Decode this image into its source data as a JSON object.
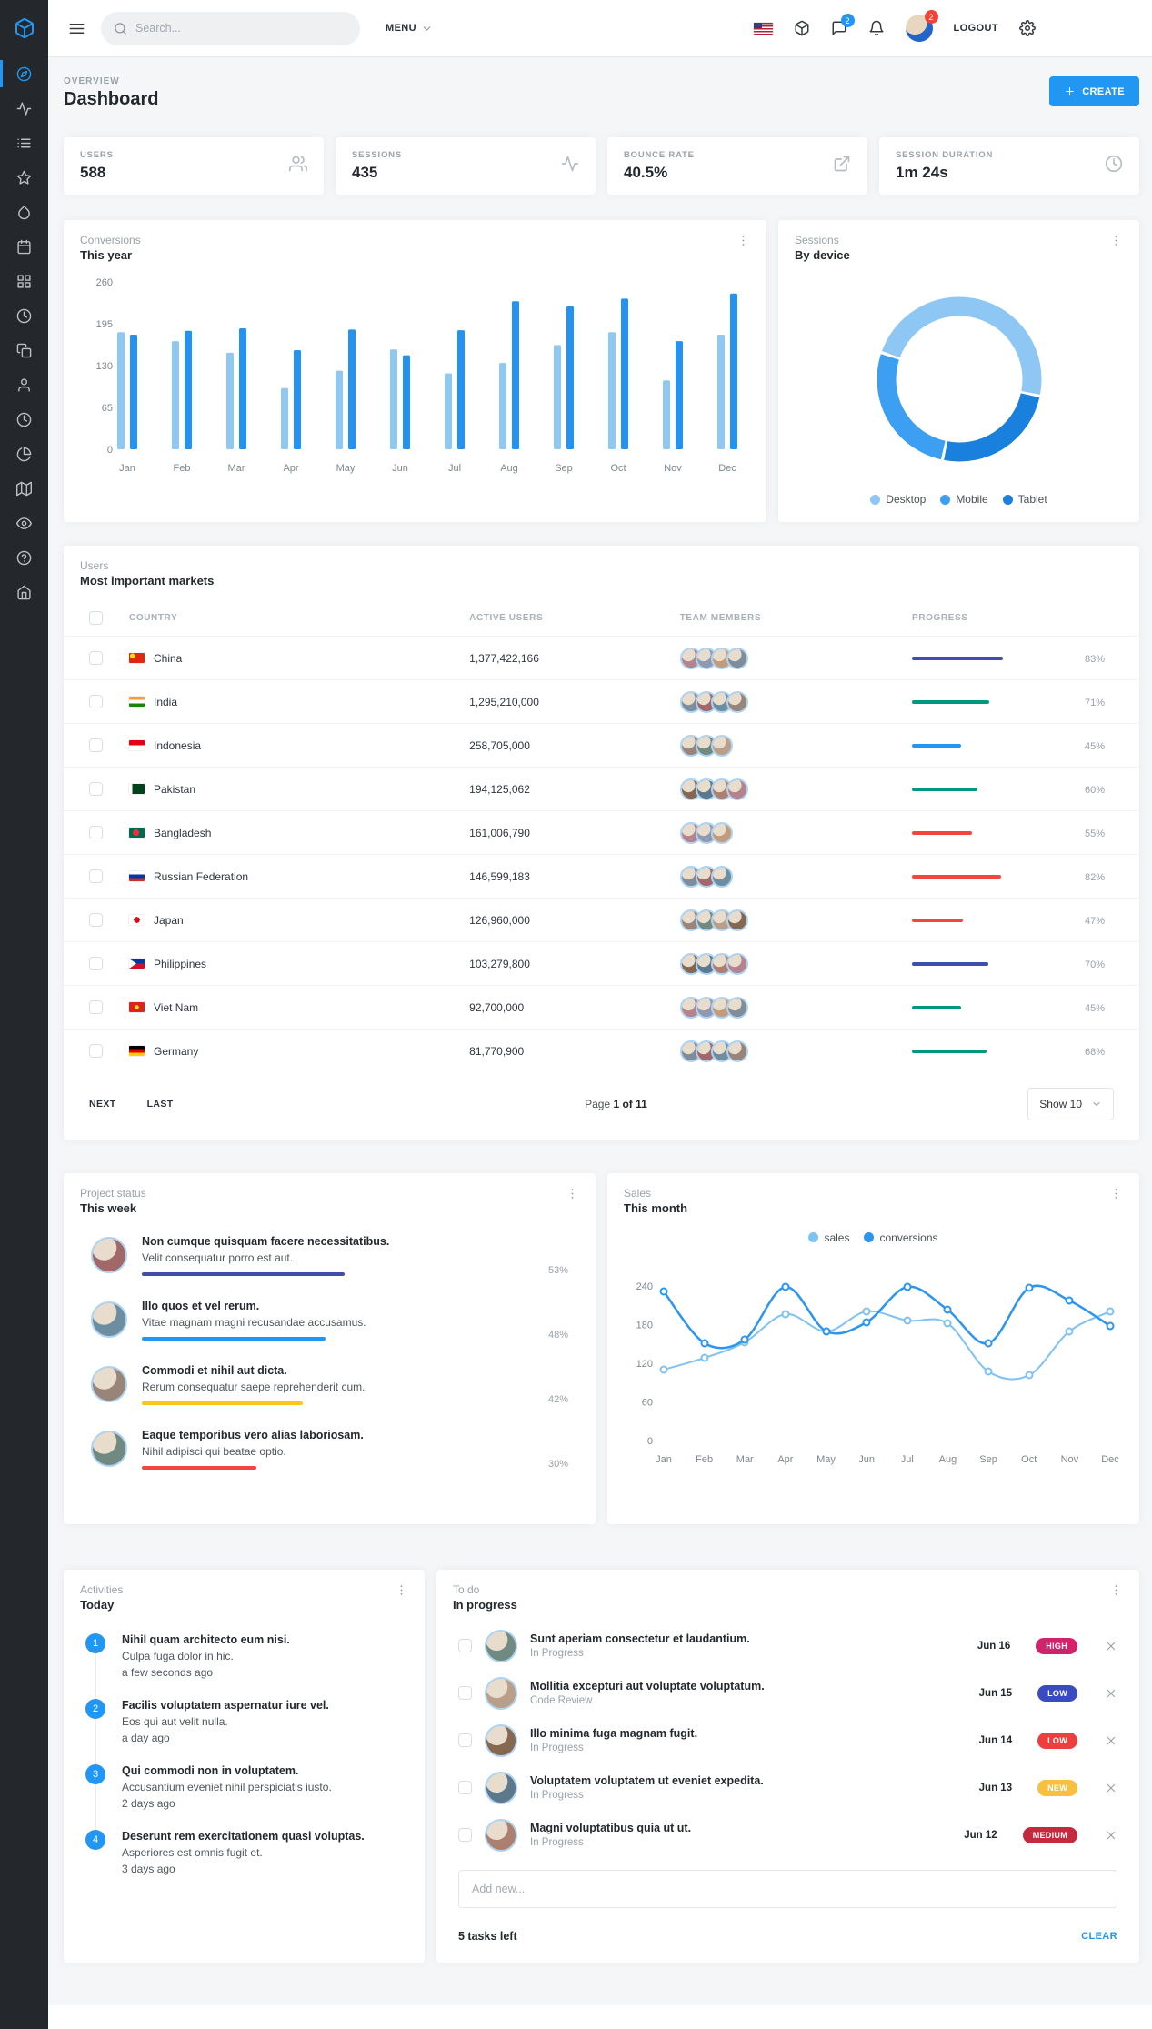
{
  "topbar": {
    "search_placeholder": "Search...",
    "menu": "MENU",
    "logout": "LOGOUT",
    "message_badge": "2",
    "profile_badge": "2"
  },
  "sidebar": {
    "active_index": 0,
    "items": [
      "compass",
      "activity",
      "list",
      "star",
      "droplet",
      "calendar",
      "grid",
      "clock",
      "copy",
      "user",
      "clock",
      "pie",
      "map",
      "eye",
      "help",
      "home"
    ]
  },
  "page_header": {
    "kicker": "OVERVIEW",
    "title": "Dashboard",
    "create": "CREATE"
  },
  "stats": [
    {
      "label": "USERS",
      "value": "588",
      "icon": "users"
    },
    {
      "label": "SESSIONS",
      "value": "435",
      "icon": "activity"
    },
    {
      "label": "BOUNCE RATE",
      "value": "40.5%",
      "icon": "external"
    },
    {
      "label": "SESSION DURATION",
      "value": "1m 24s",
      "icon": "clock"
    }
  ],
  "conversions": {
    "kicker": "Conversions",
    "title": "This year",
    "type": "bar",
    "categories": [
      "Jan",
      "Feb",
      "Mar",
      "Apr",
      "May",
      "Jun",
      "Jul",
      "Aug",
      "Sep",
      "Oct",
      "Nov",
      "Dec"
    ],
    "y_ticks": [
      260,
      195,
      130,
      65,
      0
    ],
    "y_max": 260,
    "series": [
      {
        "color": "#8fc9f2",
        "values": [
          182,
          168,
          150,
          95,
          122,
          155,
          118,
          134,
          162,
          182,
          107,
          178
        ]
      },
      {
        "color": "#2492f0",
        "values": [
          178,
          184,
          188,
          154,
          186,
          146,
          185,
          230,
          222,
          234,
          168,
          242
        ]
      }
    ]
  },
  "sessions": {
    "kicker": "Sessions",
    "title": "By device",
    "type": "donut",
    "segments": [
      {
        "label": "Desktop",
        "value": 48,
        "color": "#8ec7f4"
      },
      {
        "label": "Mobile",
        "value": 27,
        "color": "#3d9ff2"
      },
      {
        "label": "Tablet",
        "value": 25,
        "color": "#1981dd"
      }
    ]
  },
  "markets": {
    "kicker": "Users",
    "title": "Most important markets",
    "columns": [
      "COUNTRY",
      "ACTIVE USERS",
      "TEAM MEMBERS",
      "PROGRESS"
    ],
    "rows": [
      {
        "flag": "cn",
        "country": "China",
        "active_users": "1,377,422,166",
        "team_count": 4,
        "progress": 83,
        "color": "#3d4eae"
      },
      {
        "flag": "in",
        "country": "India",
        "active_users": "1,295,210,000",
        "team_count": 4,
        "progress": 71,
        "color": "#00997d"
      },
      {
        "flag": "id",
        "country": "Indonesia",
        "active_users": "258,705,000",
        "team_count": 3,
        "progress": 45,
        "color": "#2196f3"
      },
      {
        "flag": "pk",
        "country": "Pakistan",
        "active_users": "194,125,062",
        "team_count": 4,
        "progress": 60,
        "color": "#00997d"
      },
      {
        "flag": "bd",
        "country": "Bangladesh",
        "active_users": "161,006,790",
        "team_count": 3,
        "progress": 55,
        "color": "#f1453d"
      },
      {
        "flag": "ru",
        "country": "Russian Federation",
        "active_users": "146,599,183",
        "team_count": 3,
        "progress": 82,
        "color": "#f1453d"
      },
      {
        "flag": "jp",
        "country": "Japan",
        "active_users": "126,960,000",
        "team_count": 4,
        "progress": 47,
        "color": "#f1453d"
      },
      {
        "flag": "ph",
        "country": "Philippines",
        "active_users": "103,279,800",
        "team_count": 4,
        "progress": 70,
        "color": "#3d4eae"
      },
      {
        "flag": "vn",
        "country": "Viet Nam",
        "active_users": "92,700,000",
        "team_count": 4,
        "progress": 45,
        "color": "#00997d"
      },
      {
        "flag": "de",
        "country": "Germany",
        "active_users": "81,770,900",
        "team_count": 4,
        "progress": 68,
        "color": "#00997d"
      }
    ],
    "pagination": {
      "next": "NEXT",
      "last": "LAST",
      "page_prefix": "Page",
      "page_value": "1 of 11",
      "show": "Show 10"
    }
  },
  "project_status": {
    "kicker": "Project status",
    "title": "This week",
    "items": [
      {
        "title": "Non cumque quisquam facere necessitatibus.",
        "desc": "Velit consequatur porro est aut.",
        "percent": 53,
        "color": "#3d4eae"
      },
      {
        "title": "Illo quos et vel rerum.",
        "desc": "Vitae magnam magni recusandae accusamus.",
        "percent": 48,
        "color": "#2196f3"
      },
      {
        "title": "Commodi et nihil aut dicta.",
        "desc": "Rerum consequatur saepe reprehenderit cum.",
        "percent": 42,
        "color": "#ffc41d"
      },
      {
        "title": "Eaque temporibus vero alias laboriosam.",
        "desc": "Nihil adipisci qui beatae optio.",
        "percent": 30,
        "color": "#f1453d"
      }
    ]
  },
  "sales": {
    "kicker": "Sales",
    "title": "This month",
    "type": "line",
    "categories": [
      "Jan",
      "Feb",
      "Mar",
      "Apr",
      "May",
      "Jun",
      "Jul",
      "Aug",
      "Sep",
      "Oct",
      "Nov",
      "Dec"
    ],
    "y_ticks": [
      240,
      180,
      120,
      60,
      0
    ],
    "y_max": 240,
    "series": [
      {
        "name": "sales",
        "color": "#7fc2f2",
        "values": [
          110,
          128,
          152,
          196,
          170,
          200,
          187,
          182,
          108,
          102,
          170,
          200
        ]
      },
      {
        "name": "conversions",
        "color": "#2b95ef",
        "values": [
          232,
          151,
          157,
          238,
          170,
          184,
          238,
          203,
          151,
          237,
          217,
          178
        ]
      }
    ]
  },
  "activities": {
    "kicker": "Activities",
    "title": "Today",
    "items": [
      {
        "num": "1",
        "title": "Nihil quam architecto eum nisi.",
        "desc": "Culpa fuga dolor in hic.",
        "time": "a few seconds ago"
      },
      {
        "num": "2",
        "title": "Facilis voluptatem aspernatur iure vel.",
        "desc": "Eos qui aut velit nulla.",
        "time": "a day ago"
      },
      {
        "num": "3",
        "title": "Qui commodi non in voluptatem.",
        "desc": "Accusantium eveniet nihil perspiciatis iusto.",
        "time": "2 days ago"
      },
      {
        "num": "4",
        "title": "Deserunt rem exercitationem quasi voluptas.",
        "desc": "Asperiores est omnis fugit et.",
        "time": "3 days ago"
      }
    ]
  },
  "todo": {
    "kicker": "To do",
    "title": "In progress",
    "items": [
      {
        "title": "Sunt aperiam consectetur et laudantium.",
        "status": "In Progress",
        "date": "Jun 16",
        "badge": "HIGH",
        "badge_color": "#d2226b"
      },
      {
        "title": "Mollitia excepturi aut voluptate voluptatum.",
        "status": "Code Review",
        "date": "Jun 15",
        "badge": "LOW",
        "badge_color": "#3a4bbf"
      },
      {
        "title": "Illo minima fuga magnam fugit.",
        "status": "In Progress",
        "date": "Jun 14",
        "badge": "LOW",
        "badge_color": "#ee3f3f"
      },
      {
        "title": "Voluptatem voluptatem ut eveniet expedita.",
        "status": "In Progress",
        "date": "Jun 13",
        "badge": "NEW",
        "badge_color": "#f7c03e"
      },
      {
        "title": "Magni voluptatibus quia ut ut.",
        "status": "In Progress",
        "date": "Jun 12",
        "badge": "MEDIUM",
        "badge_color": "#c22b3d"
      }
    ],
    "add_placeholder": "Add new...",
    "tasks_left": "5 tasks left",
    "clear": "CLEAR"
  }
}
